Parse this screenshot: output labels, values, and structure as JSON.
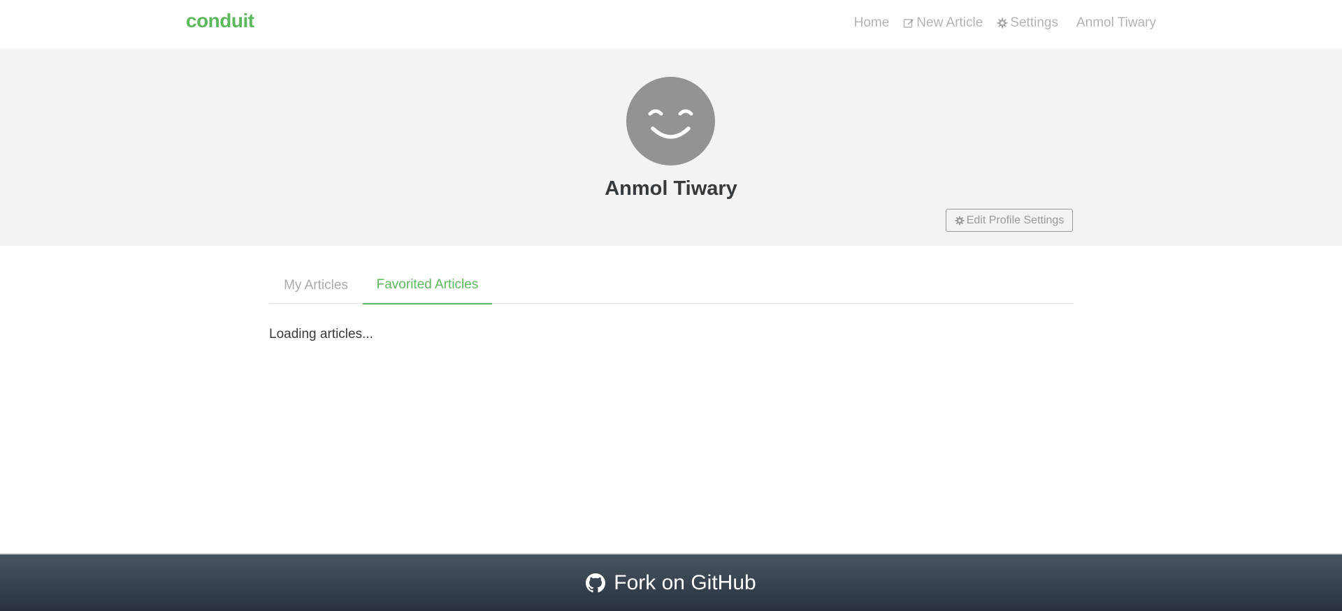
{
  "navbar": {
    "brand": "conduit",
    "links": {
      "home": "Home",
      "new_article": "New Article",
      "settings": "Settings",
      "user": "Anmol Tiwary"
    },
    "icons": {
      "new_article": "edit-icon",
      "settings": "gear-icon"
    }
  },
  "profile": {
    "avatar_icon": "smiley-avatar-icon",
    "username": "Anmol Tiwary",
    "edit_button_label": "Edit Profile Settings",
    "edit_button_icon": "gear-icon"
  },
  "tabs": {
    "my_articles": "My Articles",
    "favorited_articles": "Favorited Articles",
    "active": "favorited_articles"
  },
  "content": {
    "status": "Loading articles..."
  },
  "footer": {
    "label": "Fork on GitHub",
    "icon": "github-icon"
  },
  "colors": {
    "brand": "#5cb85c",
    "banner_bg": "#f3f3f3",
    "avatar_bg": "#939393",
    "nav_link": "rgba(0,0,0,.3)",
    "footer_top": "#485563",
    "footer_bottom": "#29323c"
  }
}
